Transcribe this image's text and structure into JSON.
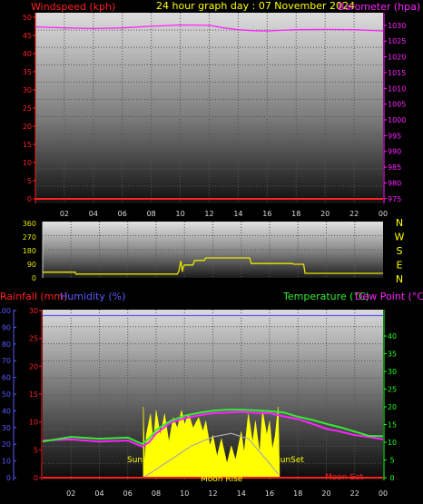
{
  "header": {
    "windspeed_label": "Windspeed (kph)",
    "title": "24 hour graph day : 07 November 2024",
    "barometer_label": "Barometer (hpa)"
  },
  "mid_header": {
    "rainfall_label": "Rainfall (mm)",
    "humidity_label": "Humidity (%)",
    "temperature_label": "Temperature (°C)",
    "dewpoint_label": "Dew Point (°C)"
  },
  "sun": {
    "rise_label": "Sunrise",
    "set_label": "SunSet"
  },
  "moon": {
    "rise_label": "Moon Rise",
    "set_label": "Moon Set"
  },
  "colors": {
    "wind": "#ff2020",
    "barometer": "#ff22ff",
    "title": "#ffff00",
    "direction": "#e6e600",
    "rain": "#ff2020",
    "humidity": "#5a5aff",
    "temperature": "#33ee33",
    "dewpoint": "#ff22ff",
    "solar": "#ffff00",
    "uv": "#aaaaaa",
    "axis_green": "#20ff20"
  },
  "chart_data": [
    {
      "type": "line",
      "title": "24 hour graph day : 07 November 2024",
      "x_tick_labels": [
        "02",
        "04",
        "06",
        "08",
        "10",
        "12",
        "14",
        "16",
        "18",
        "20",
        "22",
        "00"
      ],
      "xlim": [
        0,
        24
      ],
      "grid": true,
      "left_axis": {
        "label": "Windspeed (kph)",
        "ticks": [
          "0",
          "5",
          "10",
          "15",
          "20",
          "25",
          "30",
          "35",
          "40",
          "45",
          "50"
        ],
        "ylim": [
          0,
          50
        ]
      },
      "right_axis": {
        "label": "Barometer (hpa)",
        "ticks": [
          "975",
          "980",
          "985",
          "990",
          "995",
          "1000",
          "1005",
          "1010",
          "1015",
          "1020",
          "1025",
          "1030"
        ],
        "ylim": [
          973.5,
          1034
        ]
      },
      "series": [
        {
          "name": "Windspeed (kph)",
          "axis": "left",
          "x": [
            0,
            24
          ],
          "values": [
            0,
            0
          ]
        },
        {
          "name": "Barometer (hpa)",
          "axis": "right",
          "x": [
            0,
            2,
            4,
            6,
            8,
            10,
            12,
            13,
            14,
            15,
            16,
            17,
            18,
            20,
            22,
            24
          ],
          "values": [
            1029.5,
            1029.2,
            1029.0,
            1029.2,
            1029.7,
            1030.1,
            1030.0,
            1029.2,
            1028.6,
            1028.3,
            1028.2,
            1028.4,
            1028.6,
            1028.7,
            1028.6,
            1028.2
          ]
        }
      ]
    },
    {
      "type": "line",
      "left_axis": {
        "ticks": [
          "0",
          "90",
          "180",
          "270",
          "360"
        ],
        "ylim": [
          0,
          360
        ]
      },
      "right_labels": [
        "N",
        "W",
        "S",
        "E",
        "N"
      ],
      "xlim": [
        0,
        24
      ],
      "grid": true,
      "series": [
        {
          "name": "Wind direction",
          "x": [
            0,
            2.3,
            2.35,
            9.5,
            9.6,
            9.75,
            9.85,
            9.9,
            10.0,
            10.6,
            10.7,
            11.4,
            11.5,
            14.6,
            14.7,
            17.6,
            17.7,
            18.4,
            18.5,
            24
          ],
          "values": [
            38,
            38,
            25,
            25,
            45,
            112,
            40,
            70,
            85,
            85,
            115,
            115,
            132,
            132,
            95,
            95,
            90,
            90,
            30,
            30
          ]
        }
      ]
    },
    {
      "type": "area",
      "xlim": [
        0,
        24
      ],
      "grid": true,
      "left_axis_humidity": {
        "label": "Humidity (%)",
        "ticks": [
          "0",
          "10",
          "20",
          "30",
          "40",
          "50",
          "60",
          "70",
          "80",
          "90",
          "100"
        ],
        "ylim": [
          0,
          100
        ]
      },
      "left_axis_rain": {
        "label": "Rainfall (mm)",
        "ticks": [
          "0",
          "5",
          "10",
          "15",
          "20",
          "25",
          "30"
        ],
        "ylim": [
          0,
          30
        ]
      },
      "right_axis": {
        "label": "Temperature (°C)",
        "ticks": [
          "0",
          "5",
          "10",
          "15",
          "20",
          "25",
          "30",
          "35",
          "40"
        ],
        "ylim": [
          0,
          40
        ]
      },
      "annotations": [
        "Sunrise",
        "SunSet",
        "Moon Rise",
        "Moon Set"
      ],
      "series": [
        {
          "name": "Humidity (%)",
          "axis": "humidity",
          "x": [
            0,
            24
          ],
          "values": [
            97,
            97
          ]
        },
        {
          "name": "Temperature (°C)",
          "axis": "right",
          "x": [
            0,
            2,
            4,
            6,
            7,
            7.5,
            8,
            9,
            10,
            11,
            12,
            13,
            14,
            15,
            16,
            17,
            18,
            19,
            20,
            21,
            22,
            23,
            24
          ],
          "values": [
            10.2,
            11.5,
            11.0,
            11.3,
            9.5,
            11.0,
            13.5,
            16.0,
            17.5,
            18.3,
            18.9,
            19.2,
            19.2,
            19.0,
            18.8,
            18.4,
            17.2,
            16.3,
            15.2,
            14.2,
            13.0,
            11.8,
            11.7
          ]
        },
        {
          "name": "Dew Point (°C)",
          "axis": "right",
          "x": [
            0,
            2,
            4,
            6,
            7,
            7.5,
            8,
            9,
            10,
            11,
            12,
            13,
            14,
            15,
            16,
            17,
            18,
            19,
            20,
            21,
            22,
            23,
            24
          ],
          "values": [
            10.5,
            10.8,
            10.2,
            10.5,
            8.8,
            10.0,
            12.5,
            15.5,
            16.8,
            17.6,
            18.2,
            18.4,
            18.6,
            18.3,
            18.2,
            17.3,
            16.5,
            15.2,
            13.8,
            13.0,
            12.0,
            11.5,
            10.8
          ]
        },
        {
          "name": "Solar radiation",
          "axis": "right",
          "x": [
            7.1,
            7.2,
            7.3,
            7.6,
            7.8,
            8.0,
            8.3,
            8.6,
            8.9,
            9.2,
            9.5,
            9.8,
            10.0,
            10.3,
            10.6,
            11.0,
            11.3,
            11.5,
            11.8,
            12.0,
            12.3,
            12.6,
            13.0,
            13.3,
            13.6,
            14.0,
            14.2,
            14.5,
            14.8,
            15.0,
            15.3,
            15.5,
            15.8,
            16.0,
            16.2,
            16.4,
            16.6,
            16.7
          ],
          "values": [
            20,
            3,
            12,
            18,
            10,
            19,
            12,
            18,
            10,
            17,
            14,
            19,
            15,
            18,
            14,
            17,
            13,
            16,
            9,
            12,
            6,
            11,
            4,
            9,
            5,
            13,
            7,
            18,
            10,
            16,
            7,
            19,
            12,
            16,
            8,
            12,
            20,
            2
          ]
        },
        {
          "name": "UV",
          "axis": "right",
          "x": [
            7.1,
            9,
            10.5,
            12,
            13.3,
            14.5,
            16,
            16.6
          ],
          "values": [
            0,
            5,
            9,
            11.5,
            12.5,
            11,
            4,
            1
          ]
        },
        {
          "name": "Rainfall (mm)",
          "axis": "rain",
          "x": [
            0,
            24
          ],
          "values": [
            0,
            0
          ]
        }
      ]
    }
  ]
}
